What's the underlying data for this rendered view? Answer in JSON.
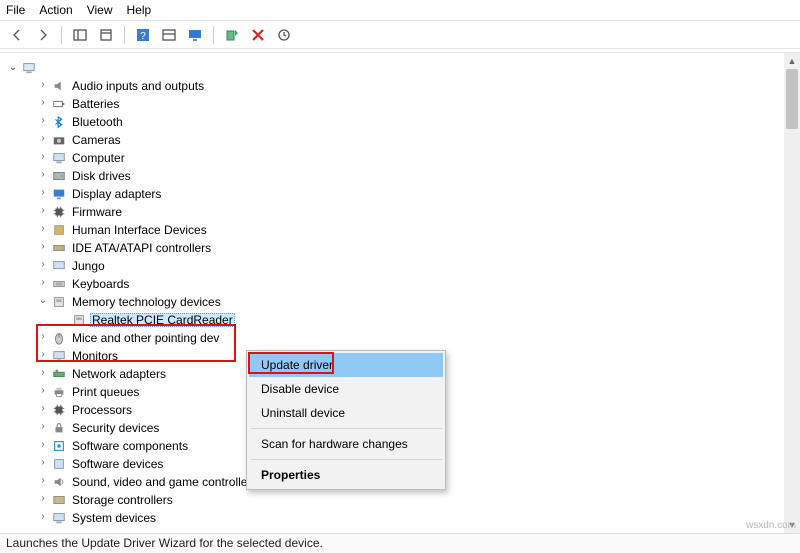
{
  "menu": {
    "file": "File",
    "action": "Action",
    "view": "View",
    "help": "Help"
  },
  "tree": {
    "root_expander": "⌄",
    "categories": [
      {
        "label": "Audio inputs and outputs"
      },
      {
        "label": "Batteries"
      },
      {
        "label": "Bluetooth"
      },
      {
        "label": "Cameras"
      },
      {
        "label": "Computer"
      },
      {
        "label": "Disk drives"
      },
      {
        "label": "Display adapters"
      },
      {
        "label": "Firmware"
      },
      {
        "label": "Human Interface Devices"
      },
      {
        "label": "IDE ATA/ATAPI controllers"
      },
      {
        "label": "Jungo"
      },
      {
        "label": "Keyboards"
      },
      {
        "label": "Memory technology devices"
      },
      {
        "label": "Mice and other pointing dev"
      },
      {
        "label": "Monitors"
      },
      {
        "label": "Network adapters"
      },
      {
        "label": "Print queues"
      },
      {
        "label": "Processors"
      },
      {
        "label": "Security devices"
      },
      {
        "label": "Software components"
      },
      {
        "label": "Software devices"
      },
      {
        "label": "Sound, video and game controllers"
      },
      {
        "label": "Storage controllers"
      },
      {
        "label": "System devices"
      }
    ],
    "selected_device": "Realtek PCIE CardReader"
  },
  "context_menu": {
    "update": "Update driver",
    "disable": "Disable device",
    "uninstall": "Uninstall device",
    "scan": "Scan for hardware changes",
    "properties": "Properties"
  },
  "statusbar": "Launches the Update Driver Wizard for the selected device.",
  "watermark": "wsxdn.com"
}
